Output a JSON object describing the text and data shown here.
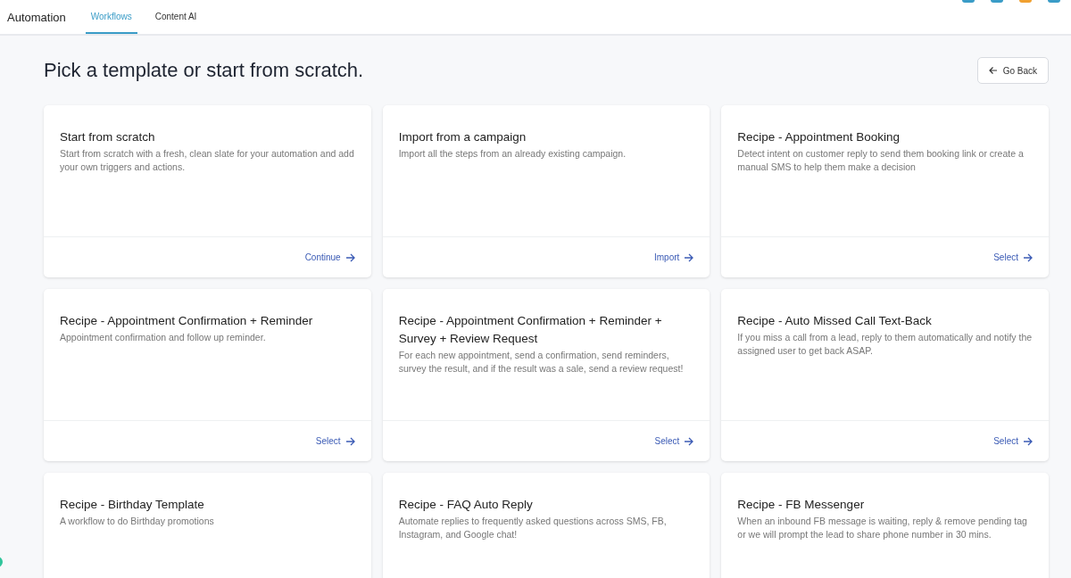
{
  "header": {
    "title": "Automation",
    "tabs": [
      {
        "label": "Workflows",
        "selected": true
      },
      {
        "label": "Content AI",
        "selected": false
      }
    ]
  },
  "page": {
    "heading": "Pick a template or start from scratch.",
    "back_button": "Go Back"
  },
  "templates": [
    {
      "title": "Start from scratch",
      "description": "Start from scratch with a fresh, clean slate for your automation and add your own triggers and actions.",
      "action": "Continue"
    },
    {
      "title": "Import from a campaign",
      "description": "Import all the steps from an already existing campaign.",
      "action": "Import"
    },
    {
      "title": "Recipe - Appointment Booking",
      "description": "Detect intent on customer reply to send them booking link or create a manual SMS to help them make a decision",
      "action": "Select"
    },
    {
      "title": "Recipe - Appointment Confirmation + Reminder",
      "description": "Appointment confirmation and follow up reminder.",
      "action": "Select"
    },
    {
      "title": "Recipe - Appointment Confirmation + Reminder + Survey + Review Request",
      "description": "For each new appointment, send a confirmation, send reminders, survey the result, and if the result was a sale, send a review request!",
      "action": "Select"
    },
    {
      "title": "Recipe - Auto Missed Call Text-Back",
      "description": "If you miss a call from a lead, reply to them automatically and notify the assigned user to get back ASAP.",
      "action": "Select"
    },
    {
      "title": "Recipe - Birthday Template",
      "description": "A workflow to do Birthday promotions"
    },
    {
      "title": "Recipe - FAQ Auto Reply",
      "description": "Automate replies to frequently asked questions across SMS, FB, Instagram, and Google chat!"
    },
    {
      "title": "Recipe - FB Messenger",
      "description": "When an inbound FB message is waiting, reply & remove pending tag or we will prompt the lead to share phone number in 30 mins."
    }
  ]
}
